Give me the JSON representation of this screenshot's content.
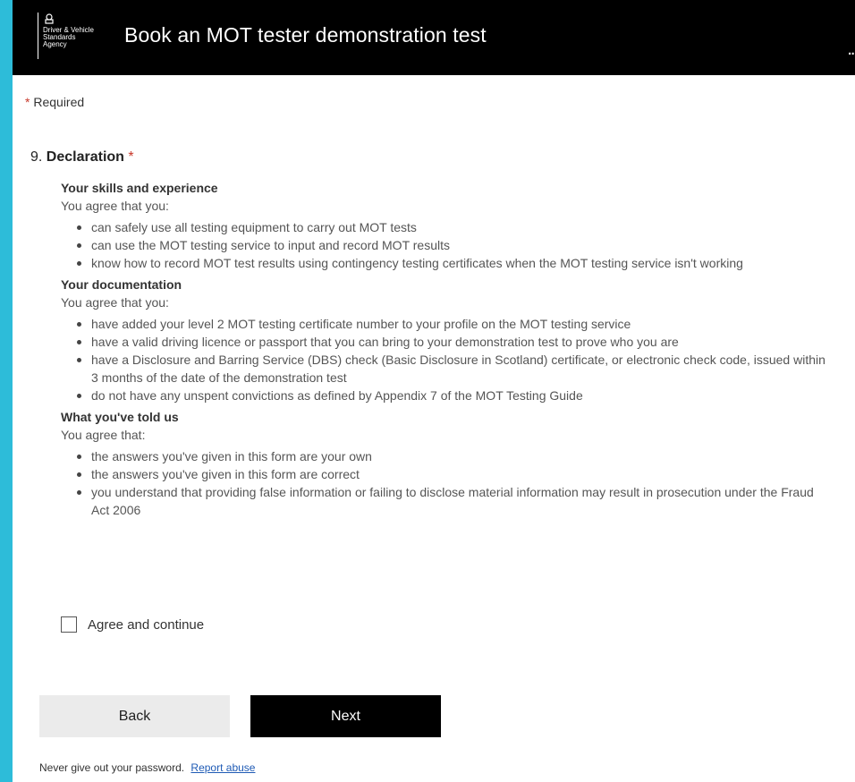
{
  "header": {
    "logo_text": "Driver & Vehicle\nStandards\nAgency",
    "title": "Book an MOT tester demonstration test",
    "more_label": "..."
  },
  "required": {
    "star": "*",
    "text": "Required"
  },
  "question": {
    "number": "9.",
    "title": "Declaration",
    "star": "*"
  },
  "sections": [
    {
      "title": "Your skills and experience",
      "intro": "You agree that you:",
      "items": [
        "can safely use all testing equipment to carry out MOT tests",
        "can use the MOT testing service to input and record MOT results",
        "know how to record MOT test results using contingency testing certificates when the MOT testing service isn't working"
      ]
    },
    {
      "title": "Your documentation",
      "intro": "You agree that you:",
      "items": [
        "have added your level 2 MOT testing certificate number to your profile on the MOT testing service",
        "have a valid driving licence or passport that you can bring to your demonstration test to prove who you are",
        "have a Disclosure and Barring Service (DBS) check (Basic Disclosure in Scotland) certificate, or electronic check code, issued within 3 months of the date of the demonstration test",
        "do not have any unspent convictions as defined by Appendix 7 of the MOT Testing Guide"
      ]
    },
    {
      "title": "What you've told us",
      "intro": "You agree that:",
      "items": [
        "the answers you've given in this form are your own",
        "the answers you've given in this form are correct",
        "you understand that providing false information or failing to disclose material information may result in prosecution under the Fraud Act 2006"
      ]
    }
  ],
  "checkbox": {
    "label": "Agree and continue",
    "checked": false
  },
  "buttons": {
    "back": "Back",
    "next": "Next"
  },
  "footer": {
    "text": "Never give out your password.",
    "link": "Report abuse"
  },
  "colors": {
    "accent_bg": "#2dbcd9",
    "header": "#000000",
    "required_star": "#c8382a",
    "link": "#1f5bb5"
  }
}
